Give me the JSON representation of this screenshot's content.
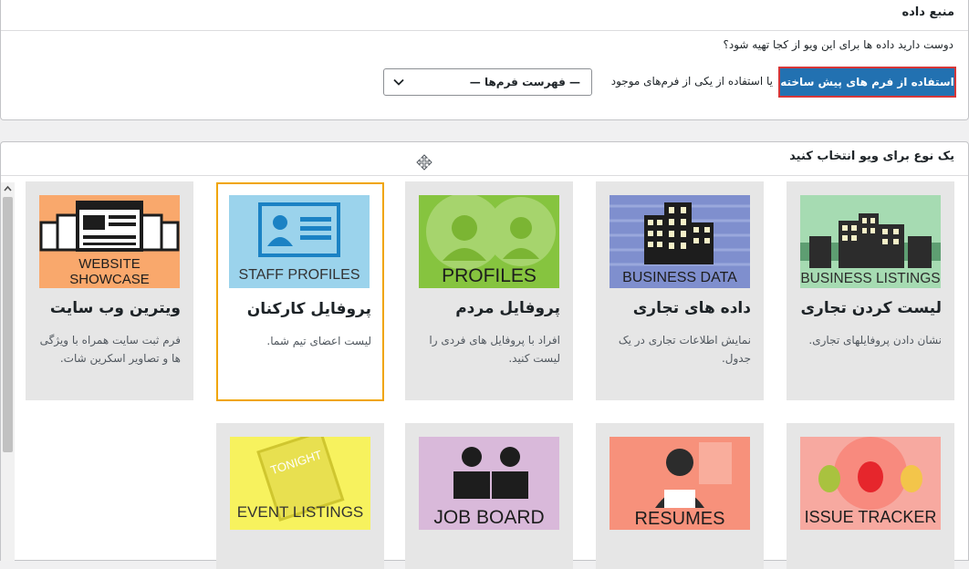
{
  "data_source": {
    "title": "منبع داده",
    "question": "دوست دارید داده ها برای این ویو از کجا تهیه شود؟",
    "primary_button": "استفاده از فرم های پیش ساخته",
    "or_text": "یا استفاده از یکی از فرم‌های موجود",
    "select_value": "— فهرست فرم‌ها —"
  },
  "view_types": {
    "title": "یک نوع برای ویو انتخاب کنید",
    "cards": [
      {
        "thumb": "BUSINESS LISTINGS",
        "title": "لیست کردن تجاری",
        "desc": "نشان دادن پروفایلهای تجاری."
      },
      {
        "thumb": "BUSINESS DATA",
        "title": "داده های تجاری",
        "desc": "نمایش اطلاعات تجاری در یک جدول."
      },
      {
        "thumb": "PROFILES",
        "title": "پروفایل مردم",
        "desc": "افراد با پروفایل های فردی را لیست کنید."
      },
      {
        "thumb": "STAFF PROFILES",
        "title": "پروفایل کارکنان",
        "desc": "لیست اعضای تیم شما."
      },
      {
        "thumb_line1": "WEBSITE",
        "thumb_line2": "SHOWCASE",
        "title": "ویترین وب سایت",
        "desc": "فرم ثبت سایت همراه با ویژگی ها و تصاویر اسکرین شات."
      },
      {
        "thumb": "ISSUE TRACKER"
      },
      {
        "thumb": "RESUMES"
      },
      {
        "thumb": "JOB BOARD"
      },
      {
        "thumb": "EVENT LISTINGS",
        "thumb_sub": "TONIGHT"
      }
    ]
  },
  "colors": {
    "primary": "#2271b1",
    "focus_outline": "#d63638",
    "selected_card_border": "#f0a500"
  }
}
